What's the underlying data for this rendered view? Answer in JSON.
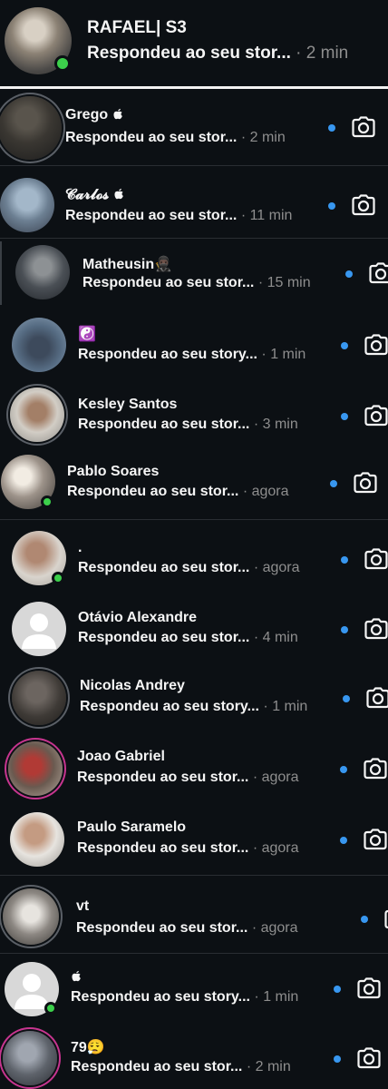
{
  "header_conversation": {
    "name": "RAFAEL| S3",
    "message": "Respondeu ao seu stor...",
    "time": "· 2 min"
  },
  "conversations": [
    {
      "name": "Grego ",
      "icon": "apple-icon",
      "message": "Respondeu ao seu stor...",
      "time": "· 2 min"
    },
    {
      "name": "𝓒𝓪𝓻𝓵𝓸𝓼 ",
      "icon": "apple-icon",
      "message": "Respondeu ao seu stor...",
      "time": "· 11 min"
    },
    {
      "name": "Matheusin🥷🏿",
      "message": "Respondeu ao seu stor...",
      "time": "· 15 min"
    },
    {
      "name": "☯️",
      "message": "Respondeu ao seu story...",
      "time": "· 1 min"
    },
    {
      "name": "Kesley Santos",
      "message": "Respondeu ao seu stor...",
      "time": "· 3 min"
    },
    {
      "name": "Pablo Soares",
      "message": "Respondeu ao seu stor...",
      "time": "· agora"
    },
    {
      "name": ".",
      "message": "Respondeu ao seu stor...",
      "time": "· agora"
    },
    {
      "name": "Otávio Alexandre",
      "message": "Respondeu ao seu stor...",
      "time": "· 4 min"
    },
    {
      "name": "Nicolas Andrey",
      "message": "Respondeu ao seu story...",
      "time": "· 1 min"
    },
    {
      "name": "Joao Gabriel",
      "message": "Respondeu ao seu stor...",
      "time": "· agora"
    },
    {
      "name": "Paulo Saramelo",
      "message": "Respondeu ao seu stor...",
      "time": "· agora"
    },
    {
      "name": "vt",
      "message": "Respondeu ao seu stor...",
      "time": "· agora"
    },
    {
      "name": "",
      "icon": "apple-icon",
      "message": "Respondeu ao seu story...",
      "time": "· 1 min"
    },
    {
      "name": "79😮‍💨",
      "message": "Respondeu ao seu stor...",
      "time": "· 2 min"
    }
  ],
  "colors": {
    "background": "#0c1014",
    "unread_dot": "#3897f0",
    "online": "#3cd04b",
    "secondary_text": "#8e8e8e"
  }
}
